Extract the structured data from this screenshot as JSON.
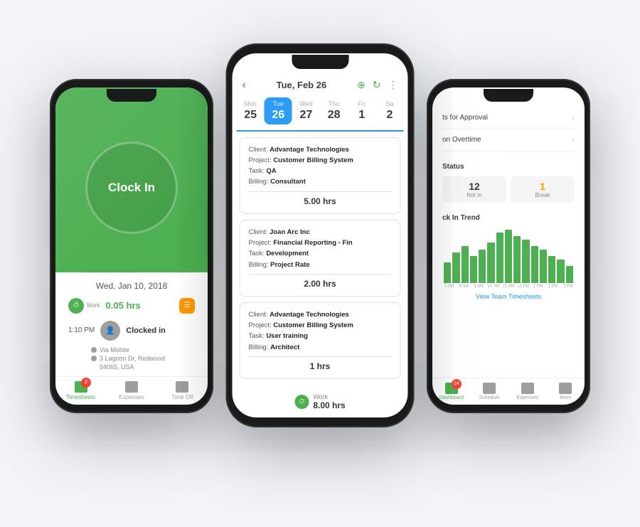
{
  "left_phone": {
    "date": "Wed, Jan 10, 2018",
    "clock_in_label": "Clock In",
    "work_label": "Work",
    "work_hrs": "0.05 hrs",
    "time": "1:10 PM",
    "clocked_in": "Clocked in",
    "via_mobile": "Via Mobile",
    "address_1": "3 Lagoon Dr, Redwood",
    "address_2": "94065, USA",
    "nav": [
      {
        "label": "Timesheets",
        "active": true,
        "badge": "3"
      },
      {
        "label": "Expenses",
        "active": false
      },
      {
        "label": "Time Off",
        "active": false
      }
    ]
  },
  "center_phone": {
    "header_date": "Tue, Feb 26",
    "week_days": [
      {
        "name": "Mon",
        "num": "25",
        "active": false
      },
      {
        "name": "Tue",
        "num": "26",
        "active": true
      },
      {
        "name": "Wed",
        "num": "27",
        "active": false
      },
      {
        "name": "Thu",
        "num": "28",
        "active": false
      },
      {
        "name": "Fri",
        "num": "1",
        "active": false
      },
      {
        "name": "Sa",
        "num": "2",
        "active": false
      }
    ],
    "timesheets": [
      {
        "client": "Advantage Technologies",
        "project": "Customer Billing System",
        "task": "QA",
        "billing": "Consultant",
        "hours": "5.00 hrs"
      },
      {
        "client": "Joan Arc Inc",
        "project": "Financial Reporting - Fin",
        "task": "Development",
        "billing": "Project Rate",
        "hours": "2.00 hrs"
      },
      {
        "client": "Advantage Technologies",
        "project": "Customer Billing System",
        "task": "User training",
        "billing": "Architect",
        "hours": "1 hrs"
      }
    ],
    "total_label": "Work",
    "total_hrs": "8.00 hrs"
  },
  "right_phone": {
    "menu_items": [
      {
        "label": "ts for Approval"
      },
      {
        "label": "on Overtime"
      }
    ],
    "status_title": "Status",
    "badges": [
      {
        "num": "12",
        "label": "Not In",
        "orange": false
      },
      {
        "num": "1",
        "label": "Break",
        "orange": true
      }
    ],
    "trend_title": "ck In Trend",
    "bar_heights": [
      30,
      45,
      55,
      40,
      50,
      60,
      75,
      80,
      70,
      65,
      55,
      50,
      40,
      35,
      25
    ],
    "trend_time_labels": [
      "7 AM",
      "8 AM",
      "9 AM",
      "10 AM",
      "11 AM",
      "12 PM",
      "1 PM",
      "2 PM",
      "3 PM"
    ],
    "view_team": "View Team Timesheets",
    "nav": [
      {
        "label": "Dashboard",
        "active": true,
        "badge": "14"
      },
      {
        "label": "Schedule",
        "active": false
      },
      {
        "label": "Expenses",
        "active": false
      },
      {
        "label": "More",
        "active": false
      }
    ]
  }
}
